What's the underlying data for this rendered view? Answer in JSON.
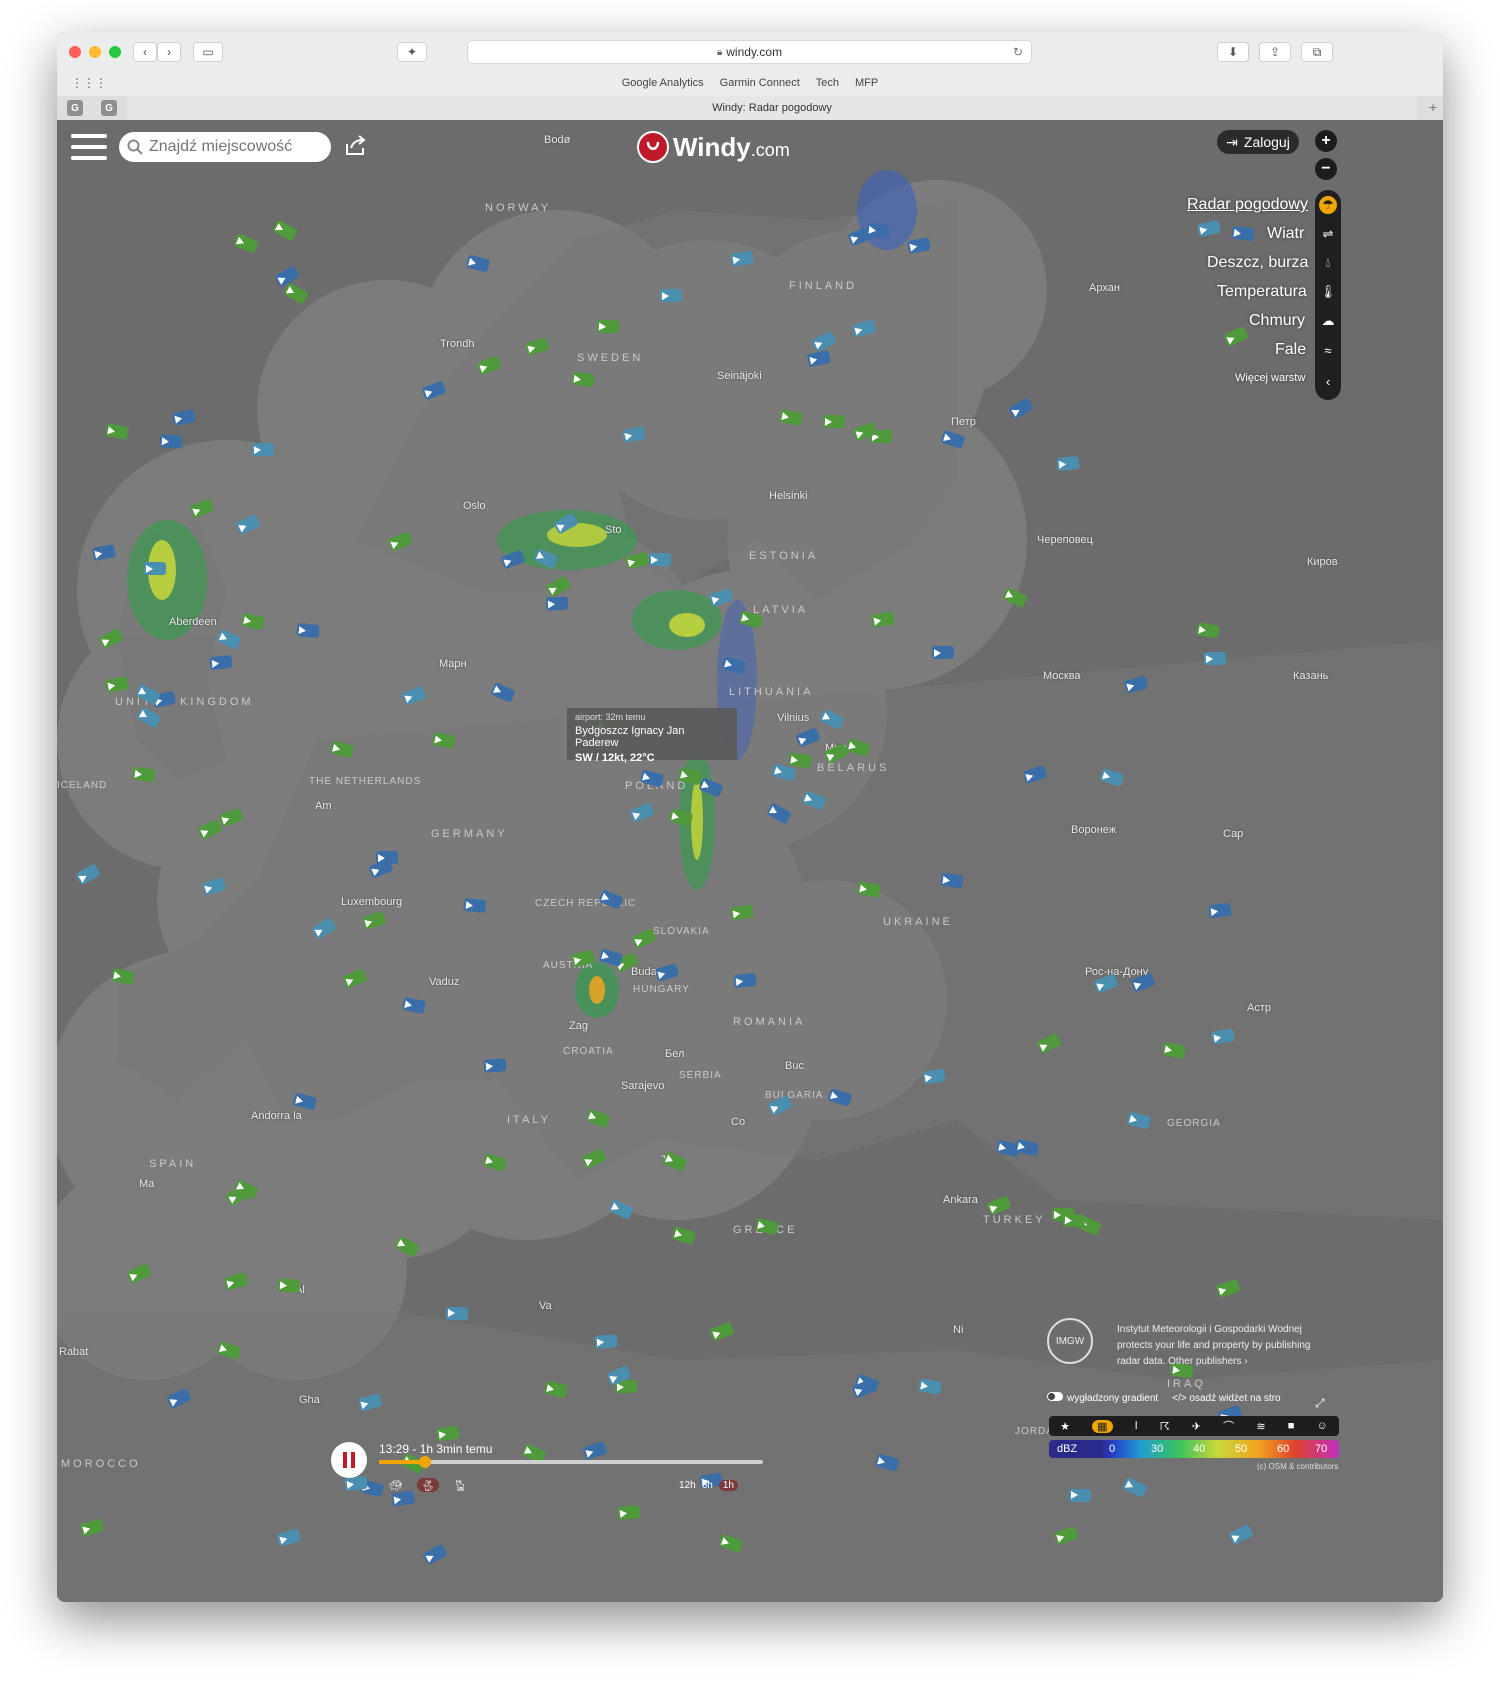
{
  "browser": {
    "url": "windy.com",
    "favorites": [
      "Google Analytics",
      "Garmin Connect",
      "Tech",
      "MFP"
    ],
    "tab_title": "Windy: Radar pogodowy",
    "pinned_tabs": [
      "G",
      "G"
    ]
  },
  "app": {
    "search_placeholder": "Znajdź miejscowość",
    "logo_text": "Windy",
    "logo_suffix": ".com",
    "login_label": "Zaloguj",
    "zoom_in": "+",
    "zoom_out": "−"
  },
  "layers": {
    "items": [
      {
        "label": "Radar pogodowy",
        "icon": "radar-icon",
        "active": true
      },
      {
        "label": "Wiatr",
        "icon": "wind-icon",
        "active": false
      },
      {
        "label": "Deszcz, burza",
        "icon": "rain-drop-icon",
        "active": false
      },
      {
        "label": "Temperatura",
        "icon": "thermometer-icon",
        "active": false
      },
      {
        "label": "Chmury",
        "icon": "cloud-icon",
        "active": false
      },
      {
        "label": "Fale",
        "icon": "waves-icon",
        "active": false
      }
    ],
    "more_label": "Więcej warstw"
  },
  "tooltip": {
    "line1": "airport: 32m temu",
    "line2": "Bydgoszcz Ignacy Jan Paderew",
    "line3": "SW / 12kt, 22°C"
  },
  "timeline": {
    "time_label": "13:29 - 1h 3min temu",
    "progress": 0.12,
    "ranges": [
      "12h",
      "6h",
      "1h"
    ],
    "active_range": "1h"
  },
  "attribution": {
    "logo_text": "IMGW",
    "text": "Instytut Meteorologii i Gospodarki Wodnej protects your life and property by publishing radar data. Other publishers ›",
    "smooth_label": "wygładzony gradient",
    "embed_label": "osadź widżet na stro"
  },
  "legend": {
    "unit": "dBZ",
    "values": [
      "0",
      "30",
      "40",
      "50",
      "60",
      "70"
    ]
  },
  "copyright": "(c) OSM & contributors",
  "map_labels": {
    "cities": [
      "Bodø",
      "Trondh",
      "Oslo",
      "Aberdeen",
      "Seinäjoki",
      "Helsinki",
      "Sto",
      "Vilnius",
      "Мин",
      "Москва",
      "Архан",
      "Петр",
      "Череповец",
      "Киров",
      "Казань",
      "Воронеж",
      "Сар",
      "Рос-на-Дону",
      "Астр",
      "Luxembourg",
      "Am",
      "Vaduz",
      "Buda",
      "Zag",
      "Бел",
      "Sarajevo",
      "Buc",
      "Co",
      "Andorra la",
      "Ma",
      "Rabat",
      "Al",
      "Tr",
      "Va",
      "Ankara",
      "Ni",
      "Gha",
      "Марн"
    ],
    "countries": [
      "NORWAY",
      "FINLAND",
      "SWEDEN",
      "ESTONIA",
      "LATVIA",
      "LITHUANIA",
      "BELARUS",
      "POLAND",
      "GERMANY",
      "THE NETHERLANDS",
      "CZECH REPUBLIC",
      "SLOVAKIA",
      "AUSTRIA",
      "HUNGARY",
      "ROMANIA",
      "UKRAINE",
      "SERBIA",
      "BULGARIA",
      "ITALY",
      "SPAIN",
      "GREECE",
      "TURKEY",
      "GEORGIA",
      "IRAQ",
      "JORDAN",
      "MOROCCO",
      "UNITED KINGDOM",
      "CROATIA",
      "ICELAND"
    ]
  },
  "wind_colors": {
    "light": "#3a6ea8",
    "medium": "#4a8fb0",
    "strong": "#4f9a3a",
    "very_strong": "#8a7a30"
  }
}
